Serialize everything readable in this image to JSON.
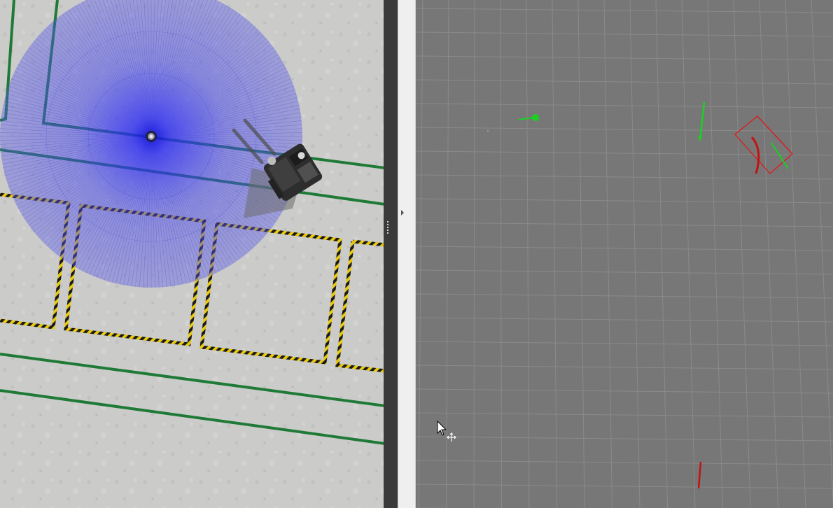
{
  "app": {
    "left_panel": "simulation-topdown-view",
    "right_panel": "visualization-grid-view"
  },
  "colors": {
    "floor": "#c9c9c7",
    "floor_lane_green": "#1e7a36",
    "hazard_yellow": "#e8c90c",
    "lidar_blue": "#2b2bff",
    "grid_background": "#777777",
    "grid_line": "#8a8a8a",
    "marker_green": "#19d11f",
    "marker_red": "#e01919"
  },
  "icons": {
    "splitter_arrow": "triangle-right",
    "cursor": "mouse-pointer-arrow",
    "move_tool": "move-cross-icon"
  }
}
